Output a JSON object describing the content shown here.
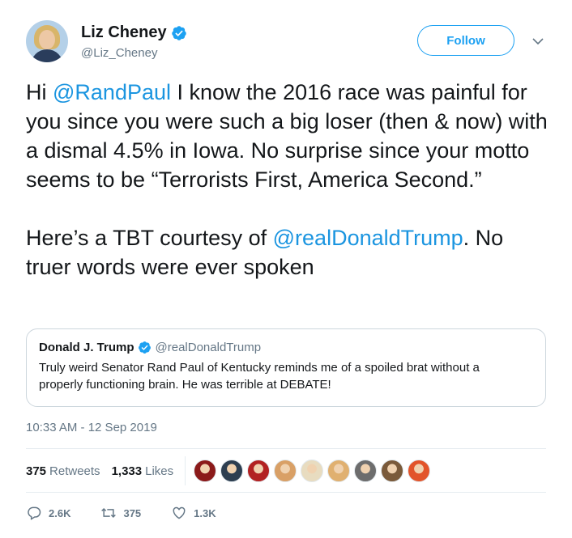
{
  "author": {
    "name": "Liz Cheney",
    "handle": "@Liz_Cheney"
  },
  "follow_label": "Follow",
  "tweet": {
    "parts": [
      {
        "text": "Hi ",
        "mention": false
      },
      {
        "text": "@RandPaul",
        "mention": true
      },
      {
        "text": " I know the 2016 race was painful for you since you were such a big loser (then & now) with a dismal 4.5% in Iowa. No surprise since your motto seems to be “Terrorists First, America Second.”\n\nHere’s a TBT courtesy of ",
        "mention": false
      },
      {
        "text": "@realDonaldTrump",
        "mention": true
      },
      {
        "text": ". No truer words were ever spoken",
        "mention": false
      }
    ]
  },
  "quote": {
    "name": "Donald J. Trump",
    "handle": "@realDonaldTrump",
    "text": "Truly weird Senator Rand Paul of Kentucky reminds me of a spoiled brat without a properly functioning brain. He was terrible at DEBATE!"
  },
  "timestamp": "10:33 AM - 12 Sep 2019",
  "stats": {
    "retweets_count": "375",
    "retweets_label": "Retweets",
    "likes_count": "1,333",
    "likes_label": "Likes"
  },
  "liker_avatars": [
    {
      "color": "#8b1a1a"
    },
    {
      "color": "#2d3e50"
    },
    {
      "color": "#b22222"
    },
    {
      "color": "#d9a066"
    },
    {
      "color": "#e8dcc0"
    },
    {
      "color": "#e0b070"
    },
    {
      "color": "#6d6d6d"
    },
    {
      "color": "#7a5a3a"
    },
    {
      "color": "#e2542a"
    }
  ],
  "actions": {
    "replies": "2.6K",
    "retweets": "375",
    "likes": "1.3K"
  },
  "colors": {
    "accent": "#1da1f2",
    "mention": "#1b95e0",
    "secondary_text": "#657786"
  }
}
